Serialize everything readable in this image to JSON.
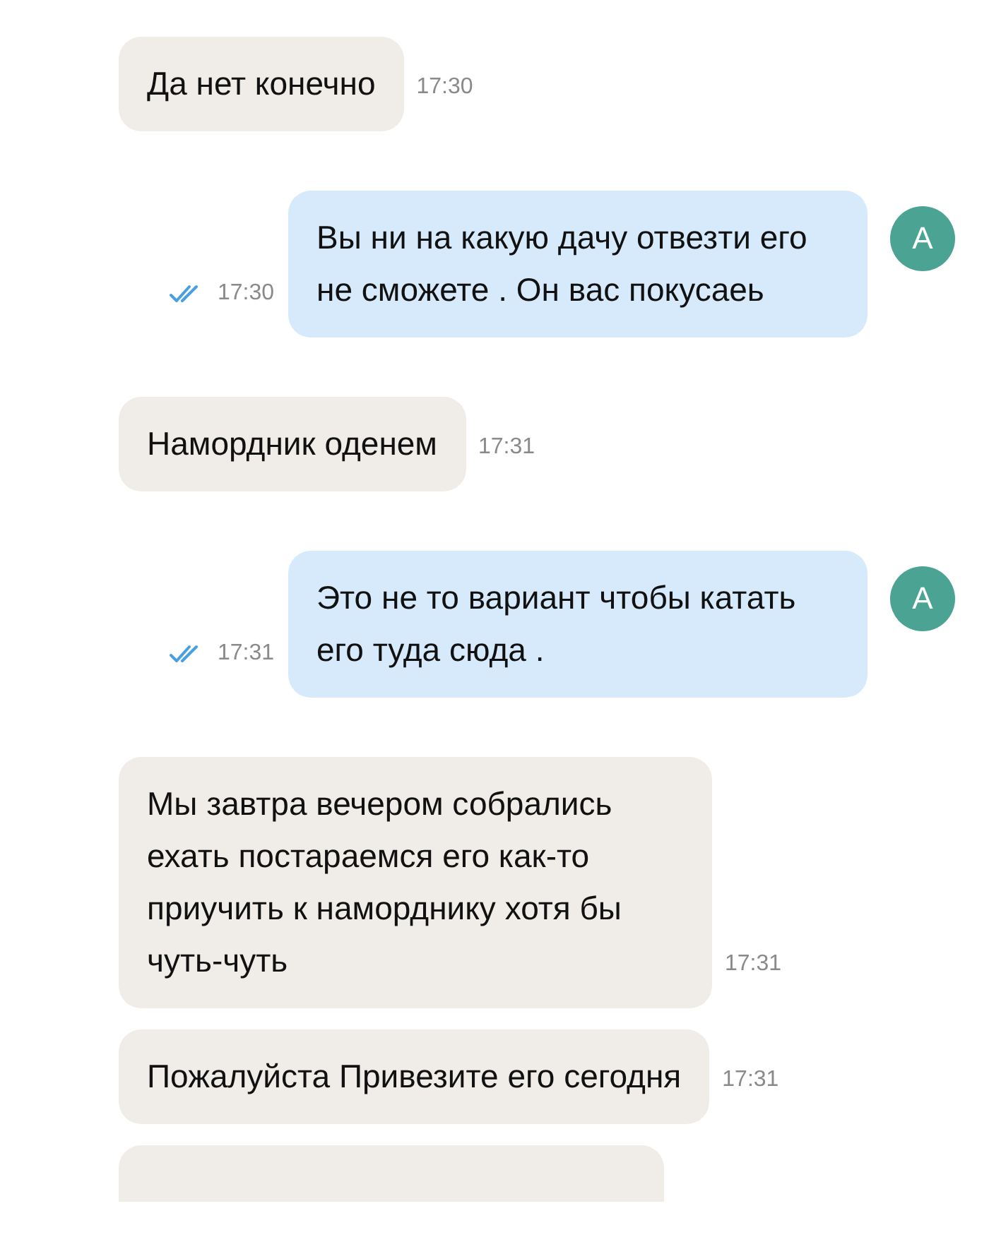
{
  "messages": [
    {
      "kind": "incoming",
      "text": "Да нет конечно",
      "time": "17:30"
    },
    {
      "kind": "outgoing",
      "text": "Вы ни на какую дачу отвезти его не сможете . Он вас покусаеь",
      "time": "17:30",
      "read": true,
      "avatar": "А"
    },
    {
      "kind": "incoming",
      "text": "Намордник оденем",
      "time": "17:31"
    },
    {
      "kind": "outgoing",
      "text": "Это не то вариант чтобы катать его туда сюда .",
      "time": "17:31",
      "read": true,
      "avatar": "А"
    },
    {
      "kind": "incoming",
      "text": "Мы завтра вечером собрались ехать постараемся его как-то приучить к наморднику хотя бы чуть-чуть",
      "time": "17:31"
    },
    {
      "kind": "incoming",
      "text": "Пожалуйста Привезите его сегодня",
      "time": "17:31"
    },
    {
      "kind": "incoming-cut"
    }
  ]
}
